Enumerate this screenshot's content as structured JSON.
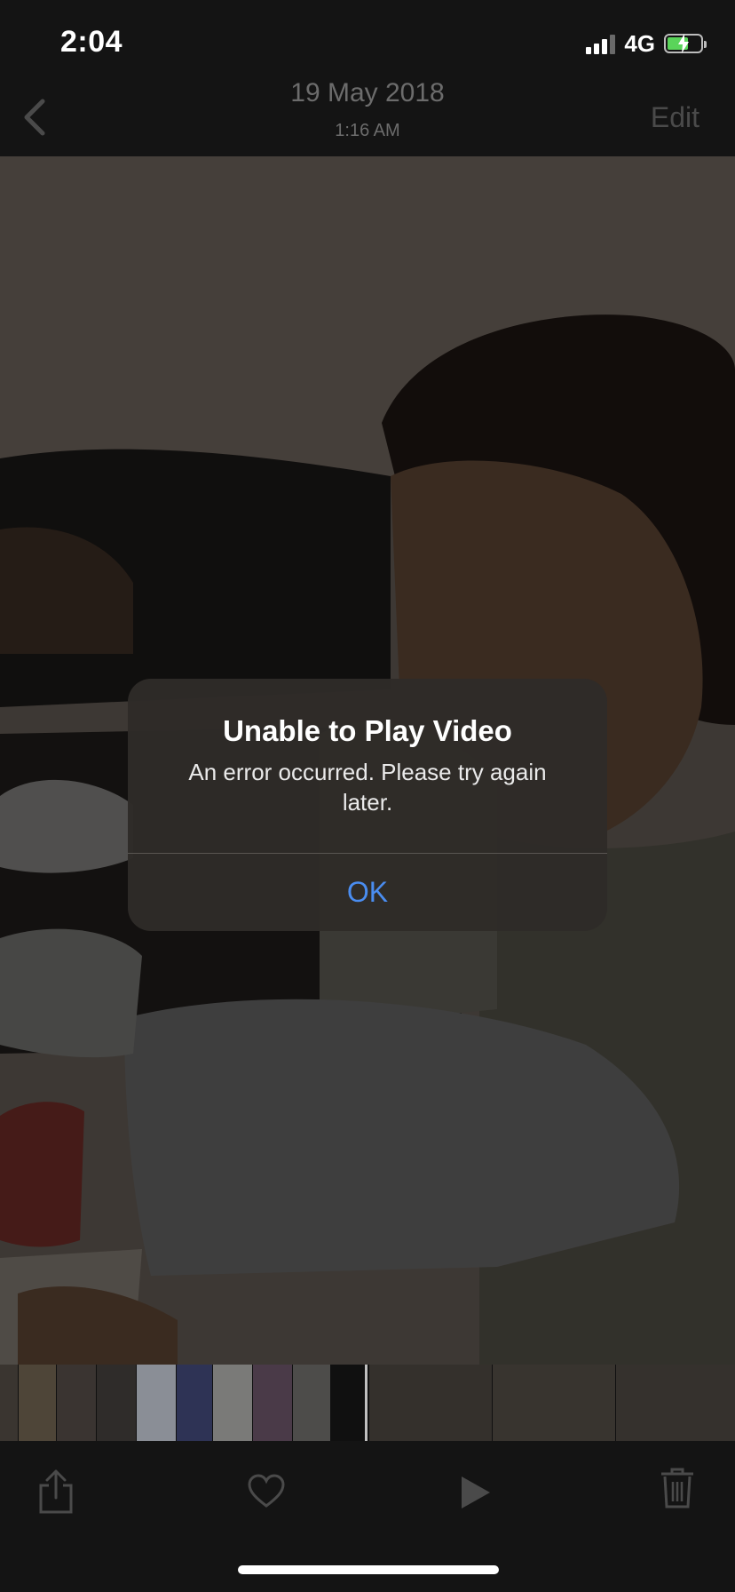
{
  "status_bar": {
    "time": "2:04",
    "network": "4G",
    "battery_level": 0.65,
    "signal_bars": "3 of 4"
  },
  "nav": {
    "title": "19 May 2018",
    "subtitle": "1:16 AM",
    "edit_label": "Edit",
    "back_icon": "chevron-left-icon"
  },
  "alert": {
    "title": "Unable to Play Video",
    "message": "An error occurred. Please try again later.",
    "ok_label": "OK",
    "accent_color": "#4a8df0"
  },
  "toolbar": {
    "icons": [
      "share-icon",
      "heart-icon",
      "play-icon",
      "trash-icon"
    ]
  },
  "colors": {
    "background": "#141414",
    "nav_text_dimmed": "#6c6c6c"
  }
}
